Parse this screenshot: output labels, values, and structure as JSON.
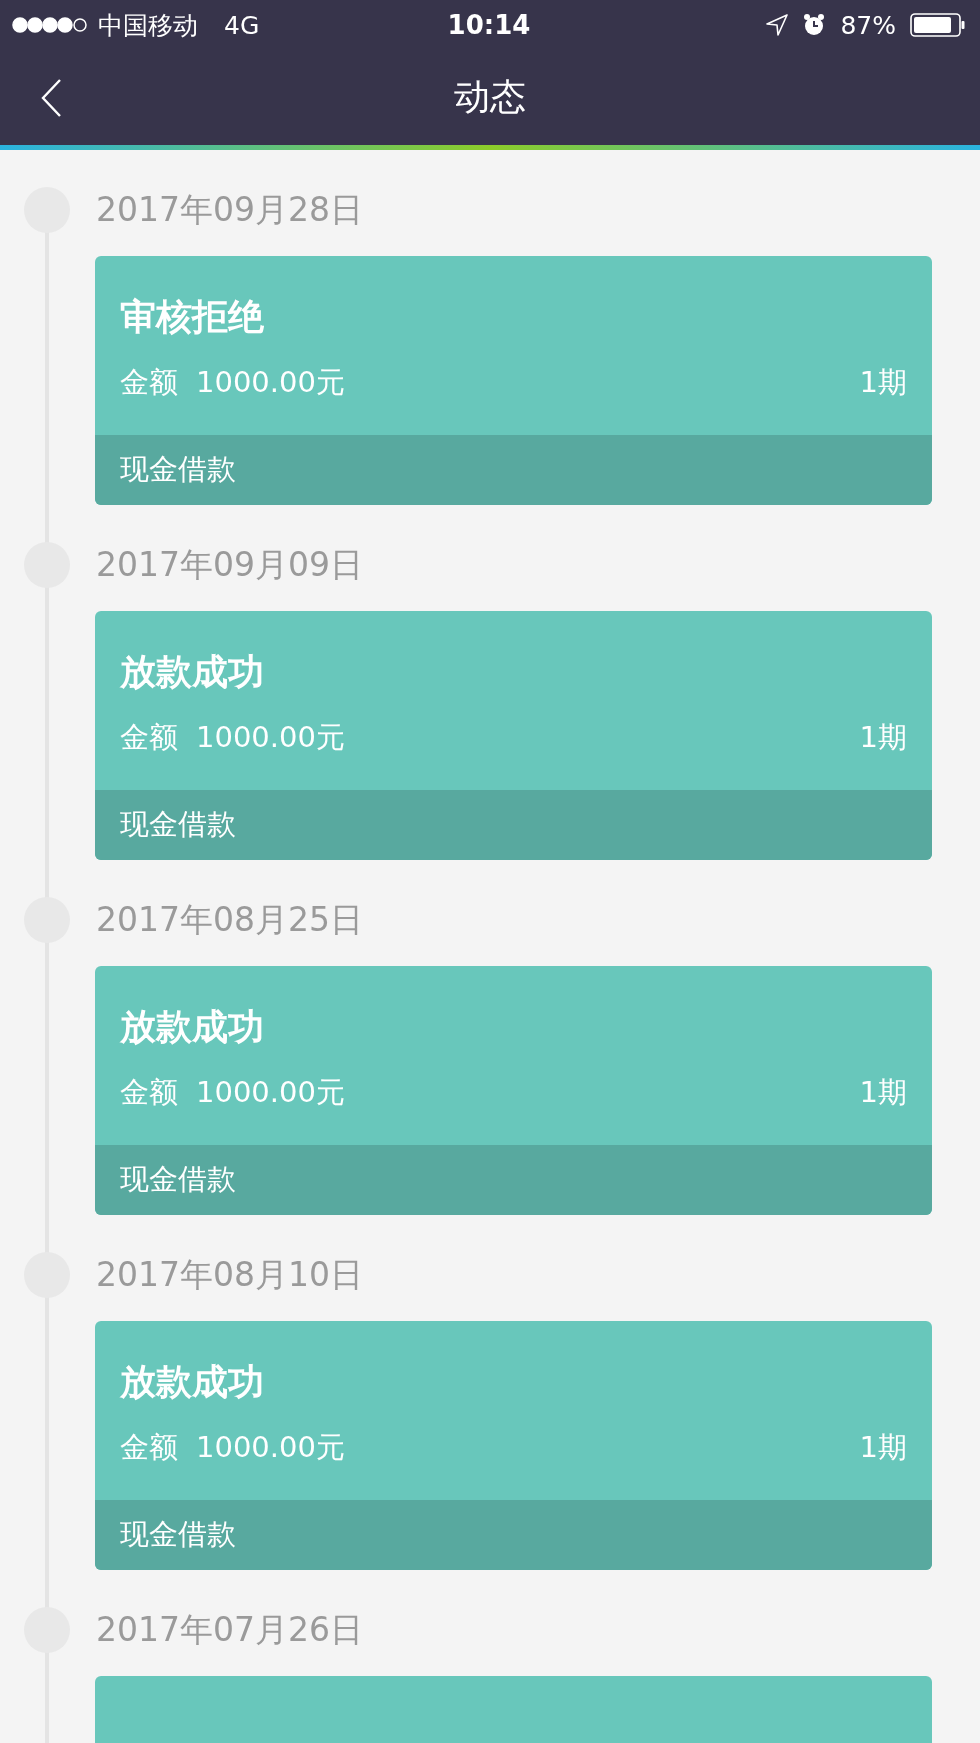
{
  "status_bar": {
    "carrier": "中国移动",
    "network": "4G",
    "time": "10:14",
    "battery": "87%"
  },
  "nav": {
    "title": "动态"
  },
  "events": [
    {
      "date": "2017年09月28日",
      "title": "审核拒绝",
      "amount_label": "金额",
      "amount": "1000.00元",
      "period": "1期",
      "product": "现金借款"
    },
    {
      "date": "2017年09月09日",
      "title": "放款成功",
      "amount_label": "金额",
      "amount": "1000.00元",
      "period": "1期",
      "product": "现金借款"
    },
    {
      "date": "2017年08月25日",
      "title": "放款成功",
      "amount_label": "金额",
      "amount": "1000.00元",
      "period": "1期",
      "product": "现金借款"
    },
    {
      "date": "2017年08月10日",
      "title": "放款成功",
      "amount_label": "金额",
      "amount": "1000.00元",
      "period": "1期",
      "product": "现金借款"
    },
    {
      "date": "2017年07月26日"
    }
  ]
}
